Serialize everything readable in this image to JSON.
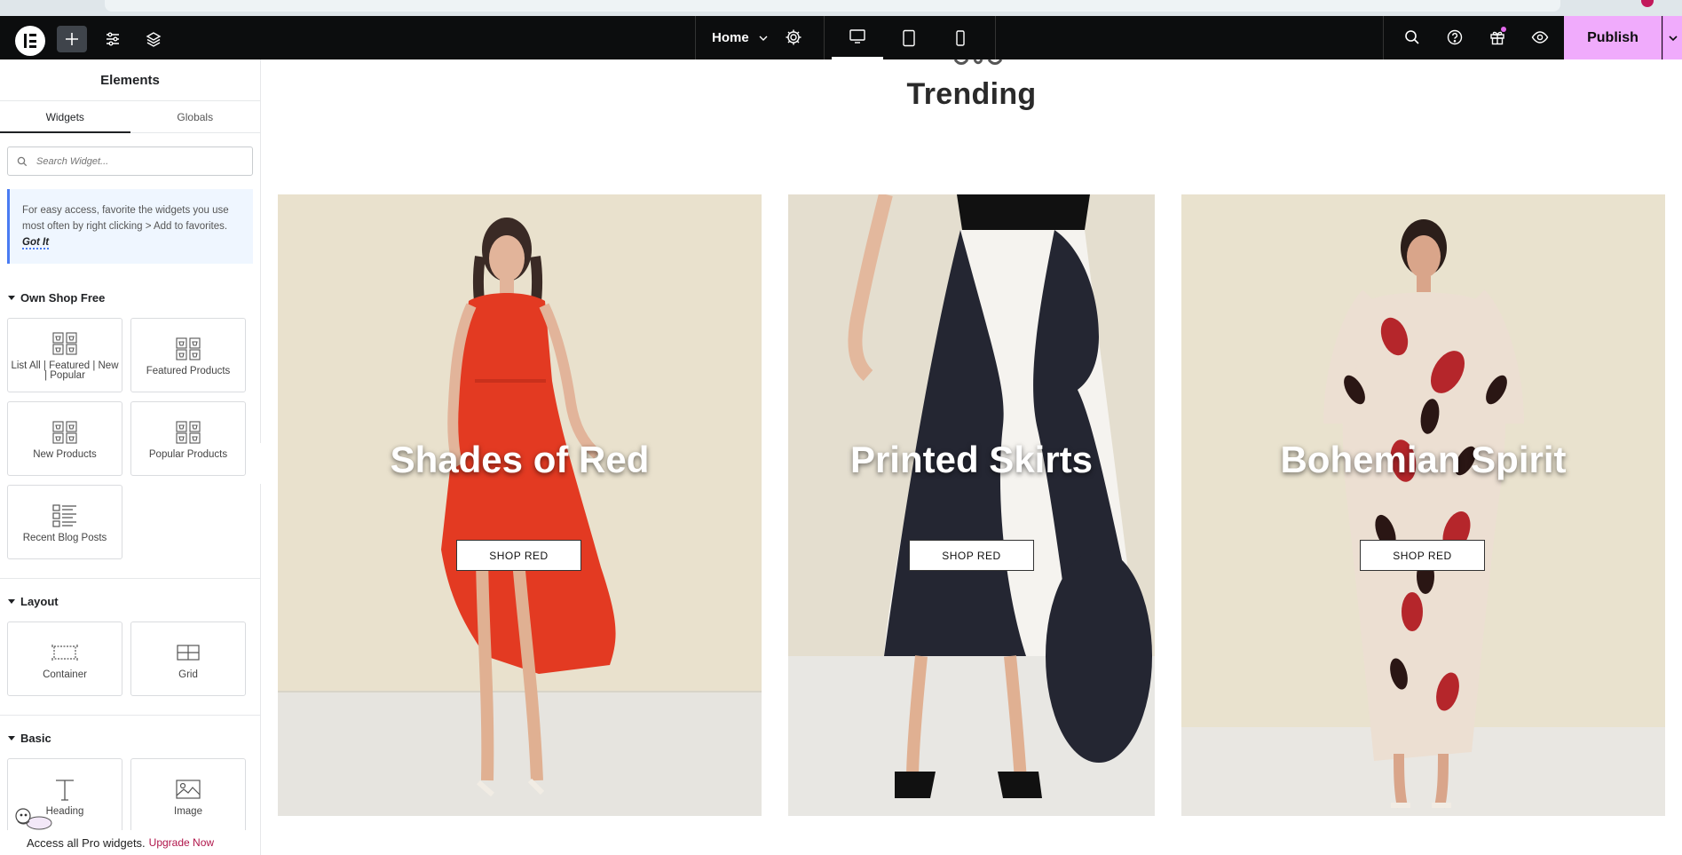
{
  "topbar": {
    "page_name": "Home",
    "publish_label": "Publish"
  },
  "sidebar": {
    "title": "Elements",
    "tabs": [
      {
        "label": "Widgets"
      },
      {
        "label": "Globals"
      }
    ],
    "search_placeholder": "Search Widget...",
    "tip_text": "For easy access, favorite the widgets you use most often by right clicking > Add to favorites.",
    "tip_action": "Got It",
    "sections": [
      {
        "title": "Own Shop Free",
        "widgets": [
          {
            "label": "List All | Featured | New | Popular",
            "icon": "products-grid-icon"
          },
          {
            "label": "Featured Products",
            "icon": "products-grid-icon"
          },
          {
            "label": "New Products",
            "icon": "products-grid-icon"
          },
          {
            "label": "Popular Products",
            "icon": "products-grid-icon"
          },
          {
            "label": "Recent Blog Posts",
            "icon": "post-list-icon"
          }
        ]
      },
      {
        "title": "Layout",
        "widgets": [
          {
            "label": "Container",
            "icon": "container-icon"
          },
          {
            "label": "Grid",
            "icon": "grid-icon"
          }
        ]
      },
      {
        "title": "Basic",
        "widgets": [
          {
            "label": "Heading",
            "icon": "heading-icon"
          },
          {
            "label": "Image",
            "icon": "image-icon"
          }
        ]
      }
    ],
    "pro_text": "Access all Pro widgets.",
    "upgrade_link": "Upgrade Now"
  },
  "canvas": {
    "section_heading": "Trending",
    "cards": [
      {
        "title": "Shades of Red",
        "button": "SHOP RED"
      },
      {
        "title": "Printed Skirts",
        "button": "SHOP RED"
      },
      {
        "title": "Bohemian Spirit",
        "button": "SHOP RED"
      }
    ]
  },
  "colors": {
    "topbar_bg": "#0c0d0e",
    "publish_bg": "#f0abfc",
    "tip_accent": "#4a7cf2",
    "upgrade_link": "#b0154a"
  }
}
